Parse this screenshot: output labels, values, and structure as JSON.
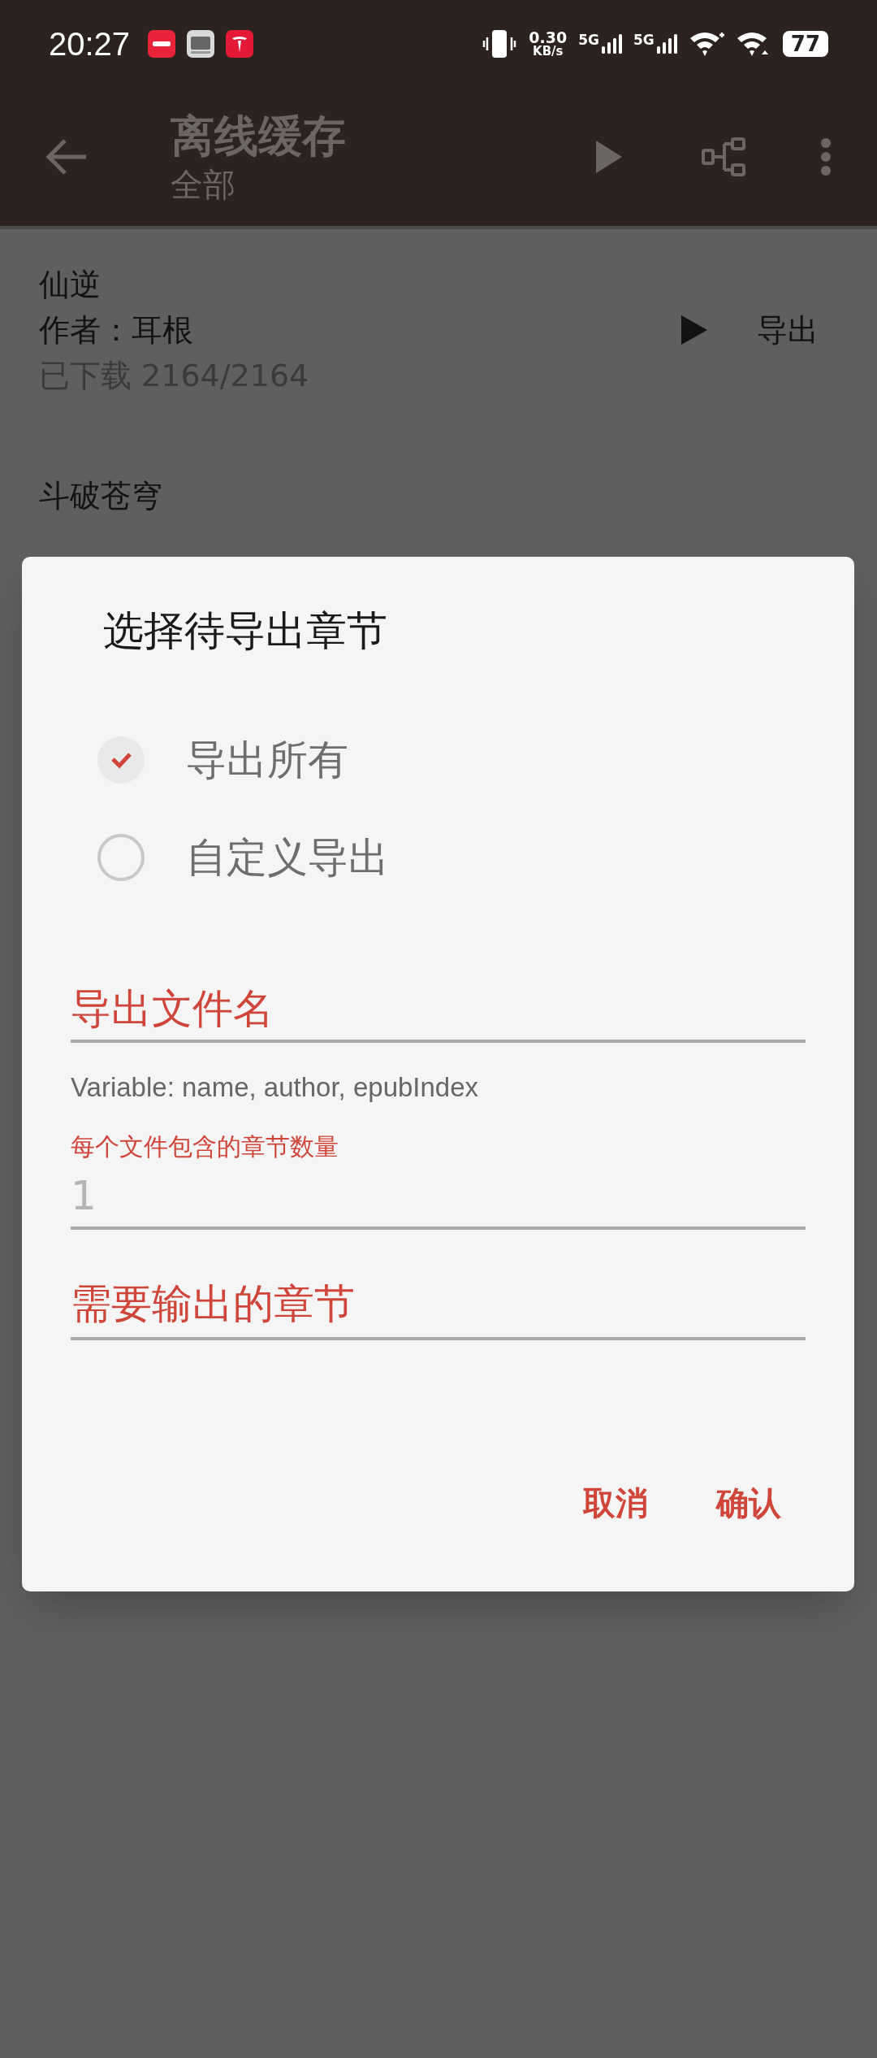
{
  "status_bar": {
    "time": "20:27",
    "net_speed": "0.30",
    "net_unit": "KB/s",
    "signals": [
      "5G",
      "5G"
    ],
    "battery": "77"
  },
  "toolbar": {
    "title": "离线缓存",
    "subtitle": "全部"
  },
  "books": [
    {
      "title": "仙逆",
      "author": "作者：耳根",
      "progress": "已下载 2164/2164",
      "action": "导出"
    },
    {
      "title": "斗破苍穹"
    }
  ],
  "dialog": {
    "title": "选择待导出章节",
    "options": [
      {
        "label": "导出所有",
        "selected": true
      },
      {
        "label": "自定义导出",
        "selected": false
      }
    ],
    "filename_field": {
      "placeholder": "导出文件名"
    },
    "hint": "Variable: name, author, epubIndex",
    "count_field": {
      "label": "每个文件包含的章节数量",
      "placeholder": "1"
    },
    "chapters_field": {
      "placeholder": "需要输出的章节"
    },
    "buttons": [
      "取消",
      "确认"
    ]
  }
}
